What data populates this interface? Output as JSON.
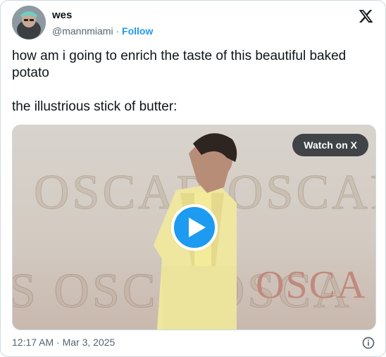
{
  "author": {
    "name": "wes",
    "handle": "@mannmiami",
    "separator": "·",
    "follow_label": "Follow"
  },
  "icons": {
    "brand": "x-logo-icon",
    "info": "info-icon",
    "play": "play-icon"
  },
  "tweet": {
    "line1": "how am i going to enrich the taste of this beautiful baked potato",
    "line2": "the illustrious stick of butter:"
  },
  "media": {
    "watch_label": "Watch on X",
    "backdrop_text_top": "OSCAR OSCAR",
    "backdrop_text_bottom": "S OSCA OSCA"
  },
  "timestamp": "12:17 AM · Mar 3, 2025",
  "colors": {
    "accent": "#1d9bf0",
    "text_primary": "#0f1419",
    "text_secondary": "#536471",
    "border": "#cfd9de",
    "suit": "#efe6a0"
  }
}
